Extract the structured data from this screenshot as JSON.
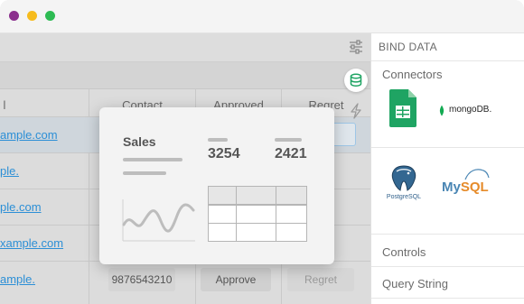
{
  "window": {
    "controls": [
      "close",
      "minimize",
      "maximize"
    ]
  },
  "table": {
    "headers": {
      "contact": "Contact",
      "approved": "Approved",
      "regret": "Regret"
    },
    "rows": [
      {
        "email": "ample.com",
        "phone": "",
        "approve": "",
        "regret": ""
      },
      {
        "email": "ple.",
        "phone": "",
        "approve": "",
        "regret": ""
      },
      {
        "email": "ple.com",
        "phone": "",
        "approve": "",
        "regret": ""
      },
      {
        "email": "xample.com",
        "phone": "",
        "approve": "",
        "regret": ""
      },
      {
        "email": "ample.",
        "phone": "9876543210",
        "approve": "Approve",
        "regret": "Regret"
      }
    ]
  },
  "card": {
    "title": "Sales",
    "stat_1": "3254",
    "stat_2": "2421"
  },
  "panel": {
    "title": "BIND DATA",
    "connectors_label": "Connectors",
    "connectors": [
      {
        "name": "Google Sheets",
        "icon": "google-sheets-icon"
      },
      {
        "name": "mongoDB",
        "icon": "mongodb-icon",
        "text": "mongoDB."
      },
      {
        "name": "PostgreSQL",
        "icon": "postgresql-icon",
        "text": "PostgreSQL"
      },
      {
        "name": "MySQL",
        "icon": "mysql-icon",
        "text_a": "My",
        "text_b": "SQL"
      }
    ],
    "controls_label": "Controls",
    "query_string_label": "Query String"
  },
  "colors": {
    "link": "#2c8fd6",
    "sheets_green": "#1fa463",
    "mongo_green": "#13aa52",
    "mysql_blue": "#4a86b4",
    "mysql_orange": "#e68b2a",
    "db_green": "#1fa463"
  }
}
